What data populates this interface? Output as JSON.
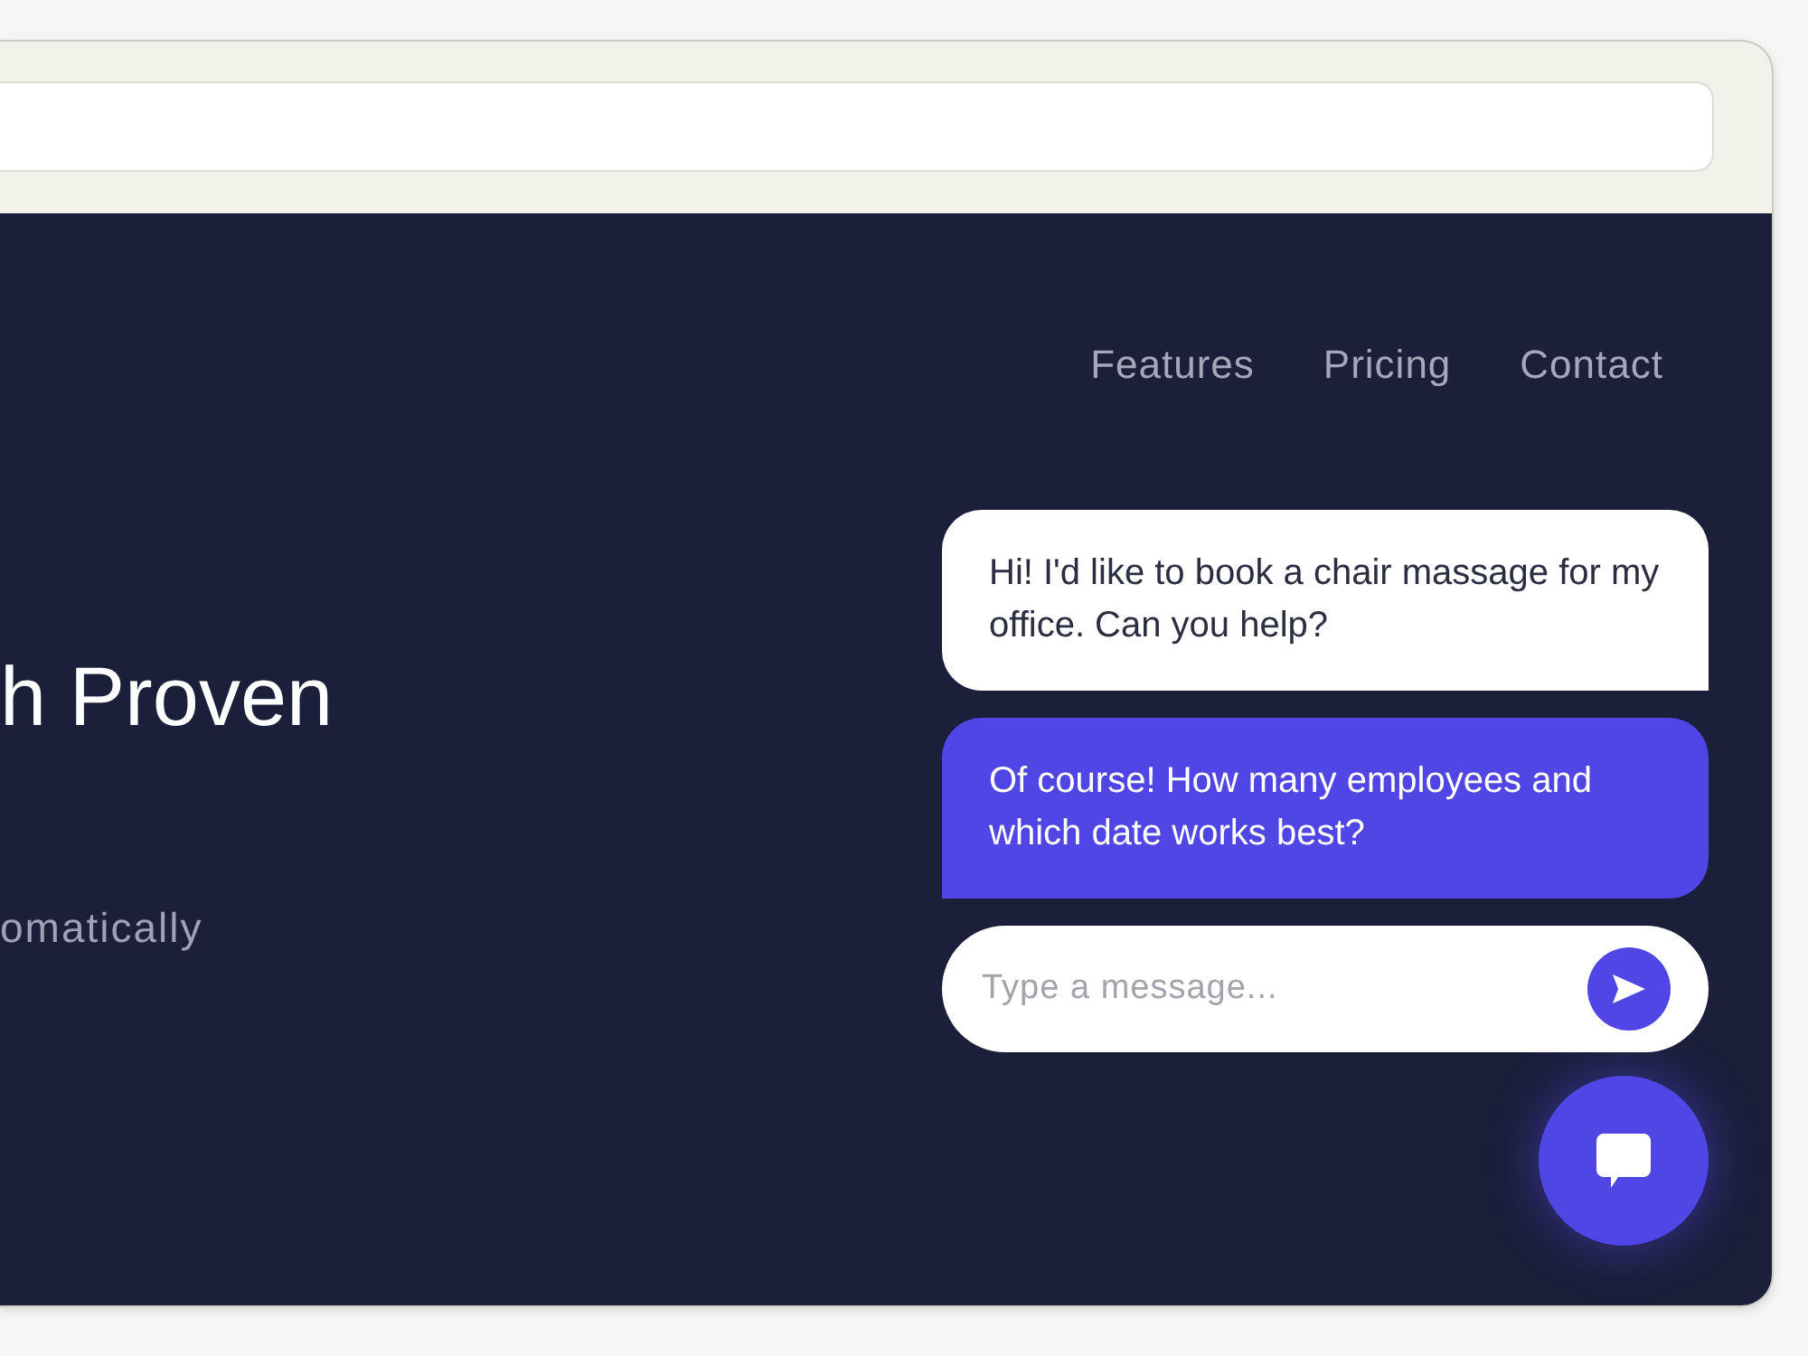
{
  "nav": {
    "links": [
      {
        "label": "Features"
      },
      {
        "label": "Pricing"
      },
      {
        "label": "Contact"
      }
    ]
  },
  "hero": {
    "heading": "h Proven",
    "subtitle": "omatically"
  },
  "chat": {
    "messages": [
      {
        "kind": "user",
        "text": "Hi! I'd like to book a chair massage for my office. Can you help?"
      },
      {
        "kind": "agent",
        "text": "Of course! How many employees and which date works best?"
      }
    ],
    "input": {
      "placeholder": "Type a message..."
    }
  }
}
